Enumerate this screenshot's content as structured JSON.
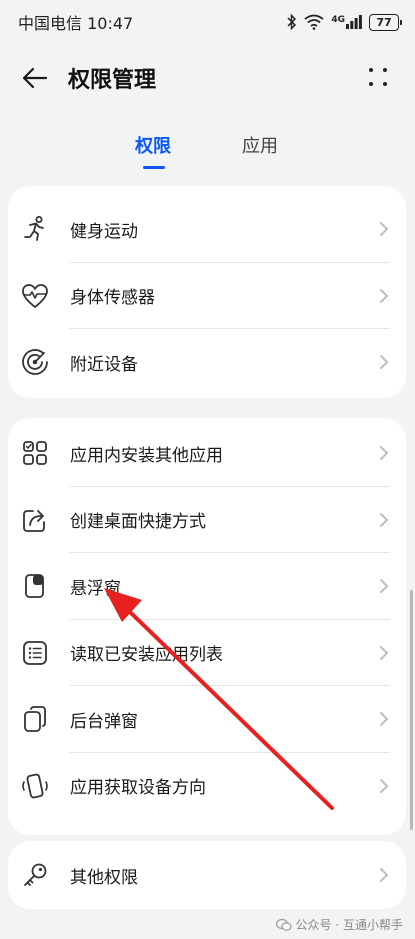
{
  "status_bar": {
    "carrier_time": "中国电信 10:47",
    "network": "4G",
    "battery": "77"
  },
  "header": {
    "title": "权限管理"
  },
  "tabs": [
    {
      "label": "权限",
      "active": true
    },
    {
      "label": "应用",
      "active": false
    }
  ],
  "sections": [
    {
      "items": [
        {
          "label": "健身运动",
          "icon": "running-icon"
        },
        {
          "label": "身体传感器",
          "icon": "heart-pulse-icon"
        },
        {
          "label": "附近设备",
          "icon": "radar-icon"
        }
      ]
    },
    {
      "items": [
        {
          "label": "应用内安装其他应用",
          "icon": "app-grid-icon"
        },
        {
          "label": "创建桌面快捷方式",
          "icon": "share-shortcut-icon"
        },
        {
          "label": "悬浮窗",
          "icon": "floating-window-icon"
        },
        {
          "label": "读取已安装应用列表",
          "icon": "list-icon"
        },
        {
          "label": "后台弹窗",
          "icon": "popup-window-icon"
        },
        {
          "label": "应用获取设备方向",
          "icon": "device-rotation-icon"
        }
      ]
    },
    {
      "items": [
        {
          "label": "其他权限",
          "icon": "key-icon"
        }
      ]
    }
  ],
  "watermark": "公众号 · 互通小帮手",
  "colors": {
    "accent": "#0a59f7",
    "annotation_arrow": "#e8201f"
  }
}
